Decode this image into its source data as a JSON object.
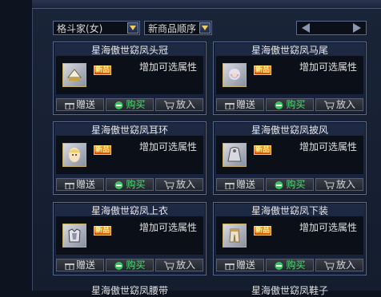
{
  "filters": {
    "category": "格斗家(女)",
    "sort": "新商品顺序"
  },
  "colors": {
    "accent_new": "#ff9a1a",
    "buy_green": "#4ee070"
  },
  "items": [
    {
      "name": "星海傲世窈凤头冠",
      "badge": "新品",
      "desc": "增加可选属性",
      "icon": "hat-icon"
    },
    {
      "name": "星海傲世窈凤马尾",
      "badge": "新品",
      "desc": "增加可选属性",
      "icon": "hair-icon"
    },
    {
      "name": "星海傲世窈凤耳环",
      "badge": "新品",
      "desc": "增加可选属性",
      "icon": "face-icon"
    },
    {
      "name": "星海傲世窈凤披风",
      "badge": "新品",
      "desc": "增加可选属性",
      "icon": "cape-icon"
    },
    {
      "name": "星海傲世窈凤上衣",
      "badge": "新品",
      "desc": "增加可选属性",
      "icon": "top-icon"
    },
    {
      "name": "星海傲世窈凤下装",
      "badge": "新品",
      "desc": "增加可选属性",
      "icon": "pants-icon"
    }
  ],
  "actions": {
    "gift": "赠送",
    "buy": "购买",
    "cart": "放入"
  },
  "partial_items": [
    {
      "name": "星海傲世窈凤腰带"
    },
    {
      "name": "星海傲世窈凤鞋子"
    }
  ]
}
